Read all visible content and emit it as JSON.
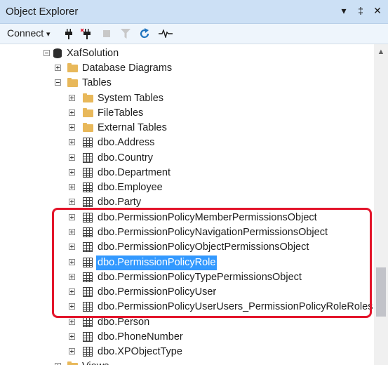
{
  "panel": {
    "title": "Object Explorer",
    "pin": "↓",
    "pin2": "⫫",
    "close": "✕"
  },
  "toolbar": {
    "connect": "Connect",
    "dropdown": "▾"
  },
  "tree": {
    "root": "XafSolution",
    "database_diagrams": "Database Diagrams",
    "tables": "Tables",
    "system_tables": "System Tables",
    "file_tables": "FileTables",
    "external_tables": "External Tables",
    "items": [
      "dbo.Address",
      "dbo.Country",
      "dbo.Department",
      "dbo.Employee",
      "dbo.Party",
      "dbo.PermissionPolicyMemberPermissionsObject",
      "dbo.PermissionPolicyNavigationPermissionsObject",
      "dbo.PermissionPolicyObjectPermissionsObject",
      "dbo.PermissionPolicyRole",
      "dbo.PermissionPolicyTypePermissionsObject",
      "dbo.PermissionPolicyUser",
      "dbo.PermissionPolicyUserUsers_PermissionPolicyRoleRoles",
      "dbo.Person",
      "dbo.PhoneNumber",
      "dbo.XPObjectType"
    ],
    "views": "Views",
    "selected": "dbo.PermissionPolicyRole"
  },
  "colors": {
    "highlight": "#e3152b",
    "selection": "#3399ff"
  }
}
